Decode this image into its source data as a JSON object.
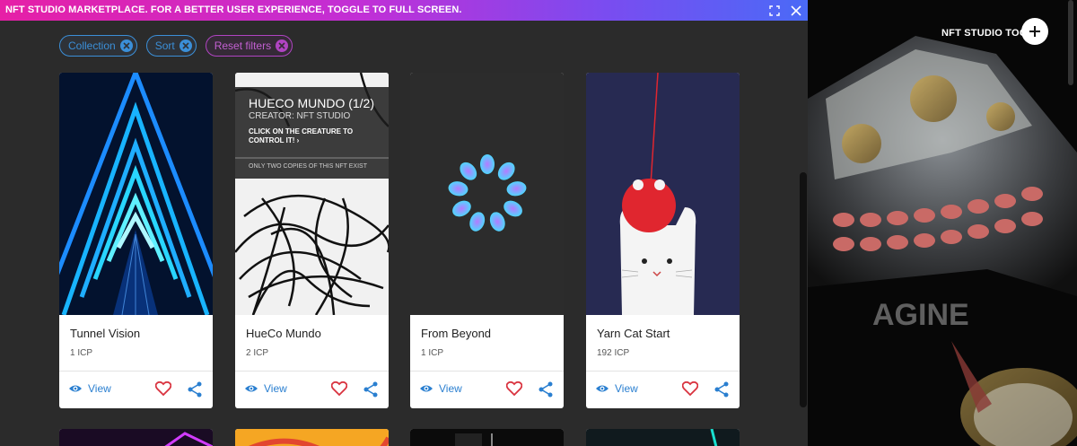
{
  "banner": {
    "text": "NFT STUDIO MARKETPLACE. FOR A BETTER USER EXPERIENCE, TOGGLE TO FULL SCREEN."
  },
  "filters": [
    {
      "label": "Collection"
    },
    {
      "label": "Sort"
    },
    {
      "label": "Reset filters"
    }
  ],
  "cards": [
    {
      "name": "Tunnel Vision",
      "price": "1 ICP",
      "view_label": "View"
    },
    {
      "name": "HueCo Mundo",
      "price": "2 ICP",
      "view_label": "View",
      "overlay": {
        "title": "HUECO MUNDO (1/2)",
        "creator": "CREATOR: NFT STUDIO",
        "instruction_line1": "CLICK ON THE CREATURE TO",
        "instruction_line2": "CONTROL IT! ›",
        "note": "ONLY TWO COPIES OF THIS NFT EXIST"
      }
    },
    {
      "name": "From Beyond",
      "price": "1 ICP",
      "view_label": "View"
    },
    {
      "name": "Yarn Cat Start",
      "price": "192 ICP",
      "view_label": "View"
    }
  ],
  "tools": {
    "label": "NFT STUDIO TOOLS"
  },
  "background": {
    "watermark": "AGINE"
  },
  "colors": {
    "accent_blue": "#2a7fd0",
    "accent_purple": "#b044c2",
    "heart_red": "#d9333f"
  }
}
